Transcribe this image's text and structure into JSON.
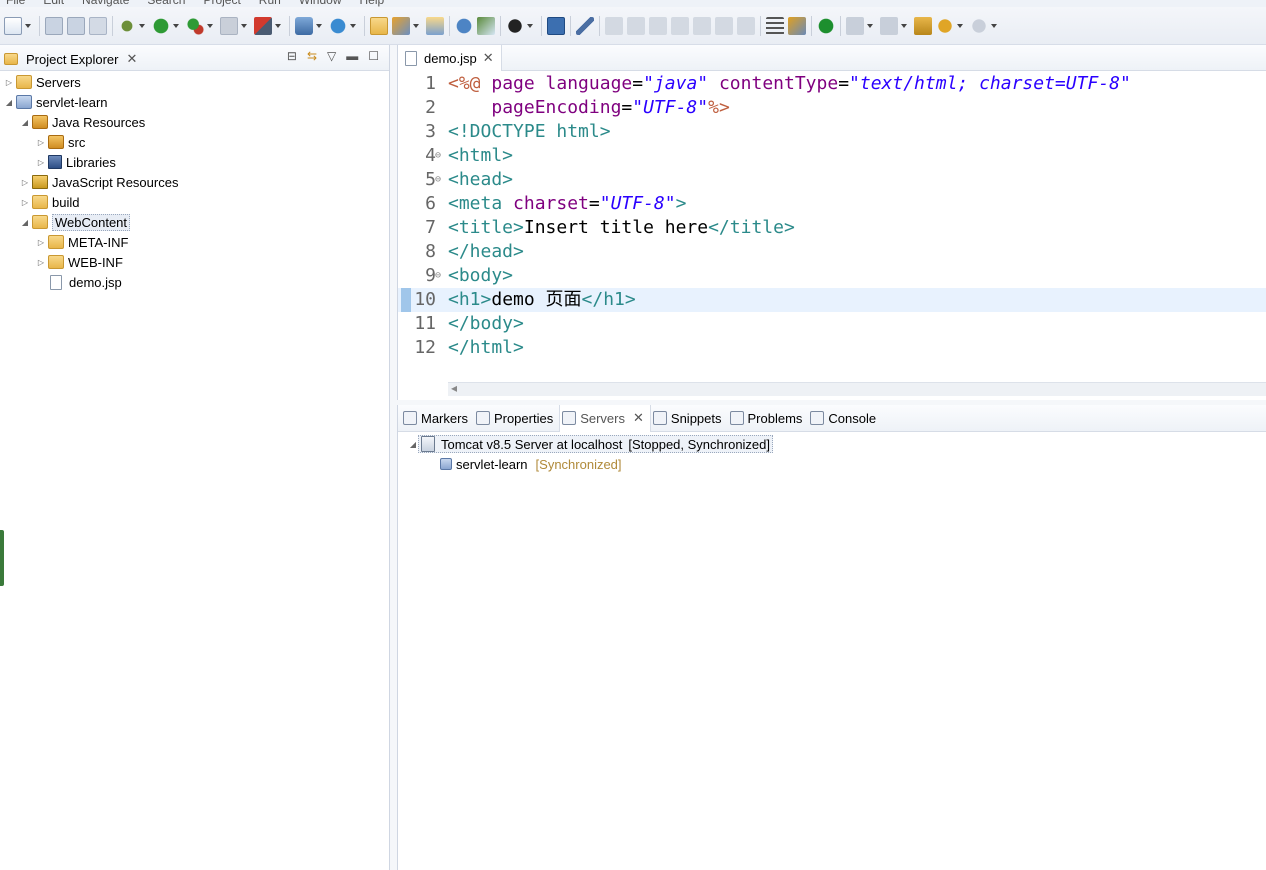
{
  "menubar": [
    "File",
    "Edit",
    "Navigate",
    "Search",
    "Project",
    "Run",
    "Window",
    "Help"
  ],
  "explorer": {
    "tab_label": "Project Explorer",
    "close_symbol": "✕",
    "tree": [
      {
        "label": "Servers",
        "level": 0,
        "expanded": false,
        "icon": "folder-icon"
      },
      {
        "label": "servlet-learn",
        "level": 0,
        "expanded": true,
        "icon": "project-icon"
      },
      {
        "label": "Java Resources",
        "level": 1,
        "expanded": true,
        "icon": "java-resources-icon"
      },
      {
        "label": "src",
        "level": 2,
        "expanded": false,
        "icon": "package-folder-icon"
      },
      {
        "label": "Libraries",
        "level": 2,
        "expanded": false,
        "icon": "library-icon"
      },
      {
        "label": "JavaScript Resources",
        "level": 1,
        "expanded": false,
        "icon": "javascript-icon"
      },
      {
        "label": "build",
        "level": 1,
        "expanded": false,
        "icon": "folder-icon"
      },
      {
        "label": "WebContent",
        "level": 1,
        "expanded": true,
        "icon": "folder-icon",
        "selected": true
      },
      {
        "label": "META-INF",
        "level": 2,
        "expanded": false,
        "icon": "folder-icon"
      },
      {
        "label": "WEB-INF",
        "level": 2,
        "expanded": false,
        "icon": "folder-icon"
      },
      {
        "label": "demo.jsp",
        "level": 2,
        "expanded": null,
        "icon": "file-icon"
      }
    ]
  },
  "editor": {
    "tab_label": "demo.jsp",
    "close_symbol": "✕",
    "lines": [
      {
        "n": "1",
        "parts": [
          [
            "dir",
            "<%@ "
          ],
          [
            "attr",
            "page "
          ],
          [
            "attr",
            "language"
          ],
          [
            "text",
            "="
          ],
          [
            "str",
            "\"java\""
          ],
          [
            "text",
            " "
          ],
          [
            "attr",
            "contentType"
          ],
          [
            "text",
            "="
          ],
          [
            "str",
            "\"text/html; charset=UTF-8\""
          ]
        ]
      },
      {
        "n": "2",
        "parts": [
          [
            "text",
            "    "
          ],
          [
            "attr",
            "pageEncoding"
          ],
          [
            "text",
            "="
          ],
          [
            "str",
            "\"UTF-8\""
          ],
          [
            "dir",
            "%>"
          ]
        ]
      },
      {
        "n": "3",
        "parts": [
          [
            "tag",
            "<!DOCTYPE "
          ],
          [
            "tag",
            "html"
          ],
          [
            "tag",
            ">"
          ]
        ]
      },
      {
        "n": "4",
        "fold": true,
        "parts": [
          [
            "tag",
            "<html>"
          ]
        ]
      },
      {
        "n": "5",
        "fold": true,
        "parts": [
          [
            "tag",
            "<head>"
          ]
        ]
      },
      {
        "n": "6",
        "parts": [
          [
            "tag",
            "<meta "
          ],
          [
            "attr",
            "charset"
          ],
          [
            "text",
            "="
          ],
          [
            "str",
            "\"UTF-8\""
          ],
          [
            "tag",
            ">"
          ]
        ]
      },
      {
        "n": "7",
        "parts": [
          [
            "tag",
            "<title>"
          ],
          [
            "text",
            "Insert title here"
          ],
          [
            "tag",
            "</title>"
          ]
        ]
      },
      {
        "n": "8",
        "parts": [
          [
            "tag",
            "</head>"
          ]
        ]
      },
      {
        "n": "9",
        "fold": true,
        "parts": [
          [
            "tag",
            "<body>"
          ]
        ]
      },
      {
        "n": "10",
        "current": true,
        "parts": [
          [
            "tag",
            "<h1>"
          ],
          [
            "text",
            "demo 页面"
          ],
          [
            "tag",
            "</h1>"
          ]
        ]
      },
      {
        "n": "11",
        "parts": [
          [
            "tag",
            "</body>"
          ]
        ]
      },
      {
        "n": "12",
        "parts": [
          [
            "tag",
            "</html>"
          ]
        ]
      }
    ]
  },
  "bottom": {
    "tabs": [
      {
        "label": "Markers",
        "icon": "markers-icon"
      },
      {
        "label": "Properties",
        "icon": "properties-icon"
      },
      {
        "label": "Servers",
        "icon": "servers-icon",
        "active": true
      },
      {
        "label": "Snippets",
        "icon": "snippets-icon"
      },
      {
        "label": "Problems",
        "icon": "problems-icon"
      },
      {
        "label": "Console",
        "icon": "console-icon"
      }
    ],
    "close_symbol": "✕",
    "servers": {
      "server_label": "Tomcat v8.5 Server at localhost",
      "server_status": "[Stopped, Synchronized]",
      "module_label": "servlet-learn",
      "module_status": "[Synchronized]"
    }
  }
}
